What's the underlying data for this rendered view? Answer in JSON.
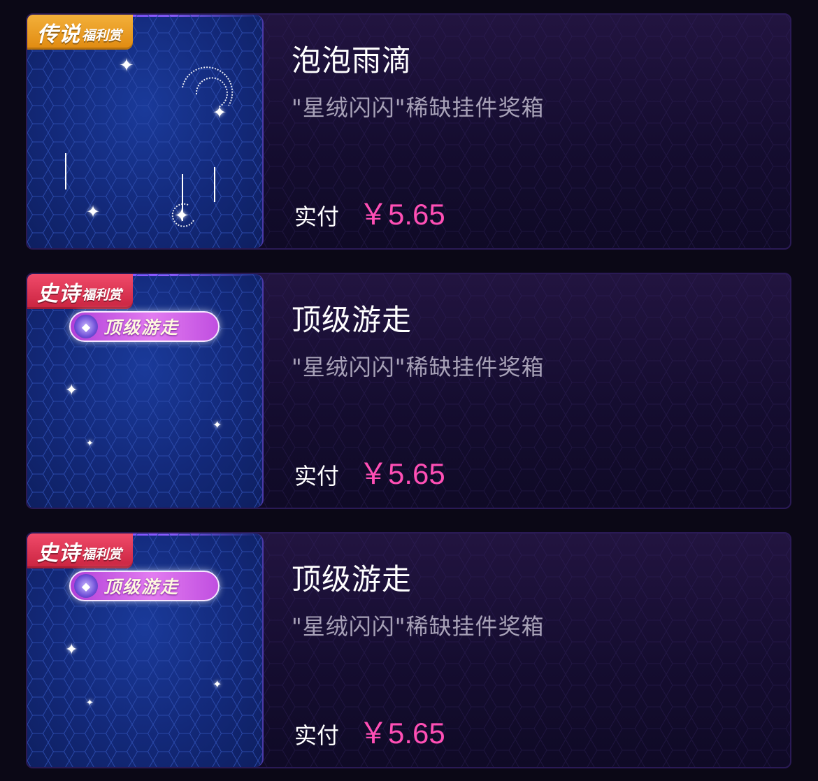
{
  "items": [
    {
      "badge": {
        "main": "传说",
        "sub": "福利赏",
        "tier": "legend",
        "color": "#e8920f"
      },
      "effect_label": null,
      "title": "泡泡雨滴",
      "subtitle": "\"星绒闪闪\"稀缺挂件奖箱",
      "price_label": "实付",
      "price": "￥5.65"
    },
    {
      "badge": {
        "main": "史诗",
        "sub": "福利赏",
        "tier": "epic",
        "color": "#d92d4b"
      },
      "effect_label": "顶级游走",
      "title": "顶级游走",
      "subtitle": "\"星绒闪闪\"稀缺挂件奖箱",
      "price_label": "实付",
      "price": "￥5.65"
    },
    {
      "badge": {
        "main": "史诗",
        "sub": "福利赏",
        "tier": "epic",
        "color": "#d92d4b"
      },
      "effect_label": "顶级游走",
      "title": "顶级游走",
      "subtitle": "\"星绒闪闪\"稀缺挂件奖箱",
      "price_label": "实付",
      "price": "￥5.65"
    }
  ],
  "colors": {
    "background": "#0b0816",
    "price": "#ff4fb5",
    "thumb_blue": "#13297a"
  }
}
